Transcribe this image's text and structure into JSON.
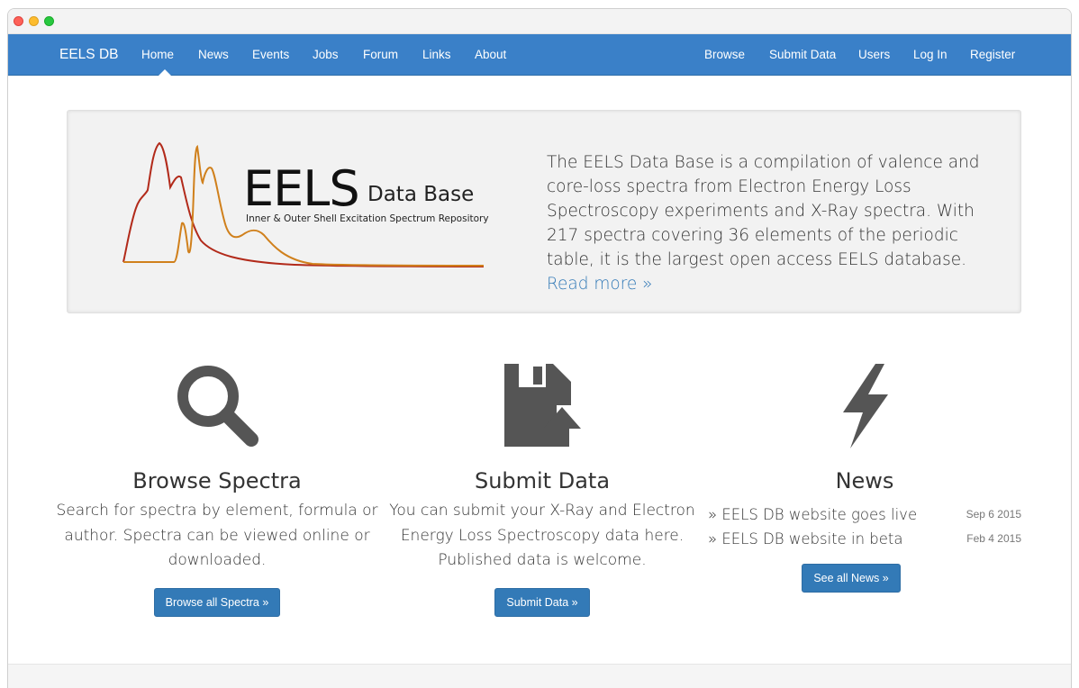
{
  "nav": {
    "brand": "EELS DB",
    "left": [
      {
        "label": "Home"
      },
      {
        "label": "News"
      },
      {
        "label": "Events"
      },
      {
        "label": "Jobs"
      },
      {
        "label": "Forum"
      },
      {
        "label": "Links"
      },
      {
        "label": "About"
      }
    ],
    "right": [
      {
        "label": "Browse"
      },
      {
        "label": "Submit Data"
      },
      {
        "label": "Users"
      },
      {
        "label": "Log In"
      },
      {
        "label": "Register"
      }
    ],
    "active": "Home",
    "color": "#3a80c8"
  },
  "logo": {
    "title": "EELS",
    "subtitle": "Data Base",
    "tagline": "Inner & Outer Shell Excitation Spectrum Repository",
    "colors": {
      "curve1": "#b22a1a",
      "curve2": "#d0801c"
    }
  },
  "intro": {
    "text": "The EELS Data Base is a compilation of valence and core-loss spectra from Electron Energy Loss Spectroscopy experiments and X-Ray spectra. With 217 spectra covering 36 elements of the periodic table, it is the largest open access EELS database.",
    "link": "Read more »"
  },
  "browse": {
    "icon": "search-icon",
    "title": "Browse Spectra",
    "text": "Search for spectra by element, formula or author. Spectra can be viewed online or downloaded.",
    "button": "Browse all Spectra »"
  },
  "submit": {
    "icon": "save-upload-icon",
    "title": "Submit Data",
    "text": "You can submit your X-Ray and Electron Energy Loss Spectroscopy data here. Published data is welcome.",
    "button": "Submit Data »"
  },
  "news": {
    "icon": "lightning-icon",
    "title": "News",
    "items": [
      {
        "text": "» EELS DB website goes live",
        "date": "Sep 6 2015"
      },
      {
        "text": "» EELS DB website in beta",
        "date": "Feb 4 2015"
      }
    ],
    "button": "See all News »"
  },
  "colors": {
    "accent": "#337ab7",
    "icon": "#555555"
  }
}
